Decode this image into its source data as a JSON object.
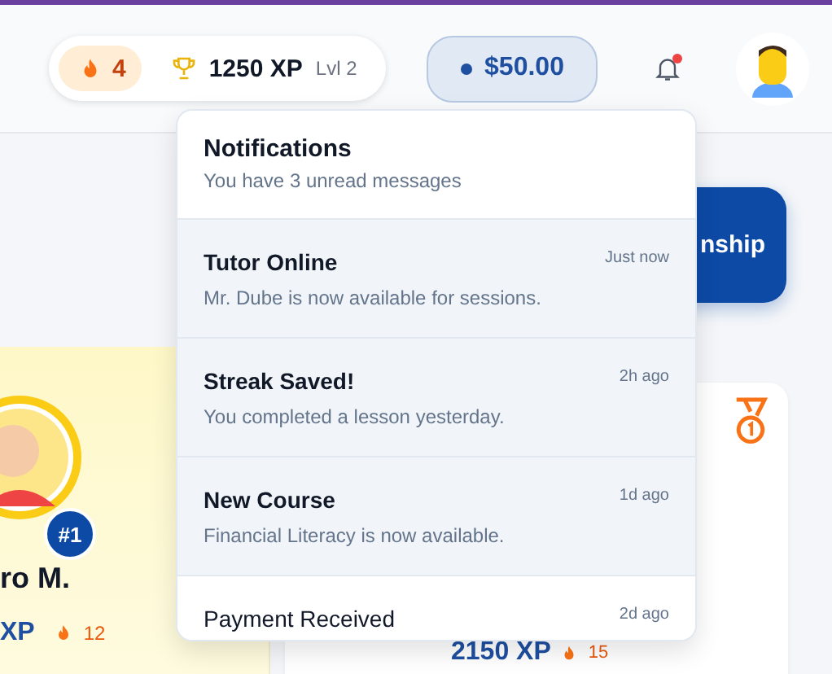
{
  "header": {
    "streak": "4",
    "xp": "1250 XP",
    "level": "Lvl 2",
    "balance": "$50.00",
    "has_unread": true
  },
  "action_button": {
    "label": "nship"
  },
  "leader_card": {
    "rank": "#1",
    "name": "ro M.",
    "xp": "XP",
    "streak": "12"
  },
  "second_card": {
    "xp": "2150 XP",
    "streak": "15"
  },
  "notifications": {
    "title": "Notifications",
    "subtitle": "You have 3 unread messages",
    "items": [
      {
        "title": "Tutor Online",
        "body": "Mr. Dube is now available for sessions.",
        "time": "Just now",
        "unread": true
      },
      {
        "title": "Streak Saved!",
        "body": "You completed a lesson yesterday.",
        "time": "2h ago",
        "unread": true
      },
      {
        "title": "New Course",
        "body": "Financial Literacy is now available.",
        "time": "1d ago",
        "unread": true
      },
      {
        "title": "Payment Received",
        "time": "2d ago",
        "unread": false
      }
    ]
  }
}
